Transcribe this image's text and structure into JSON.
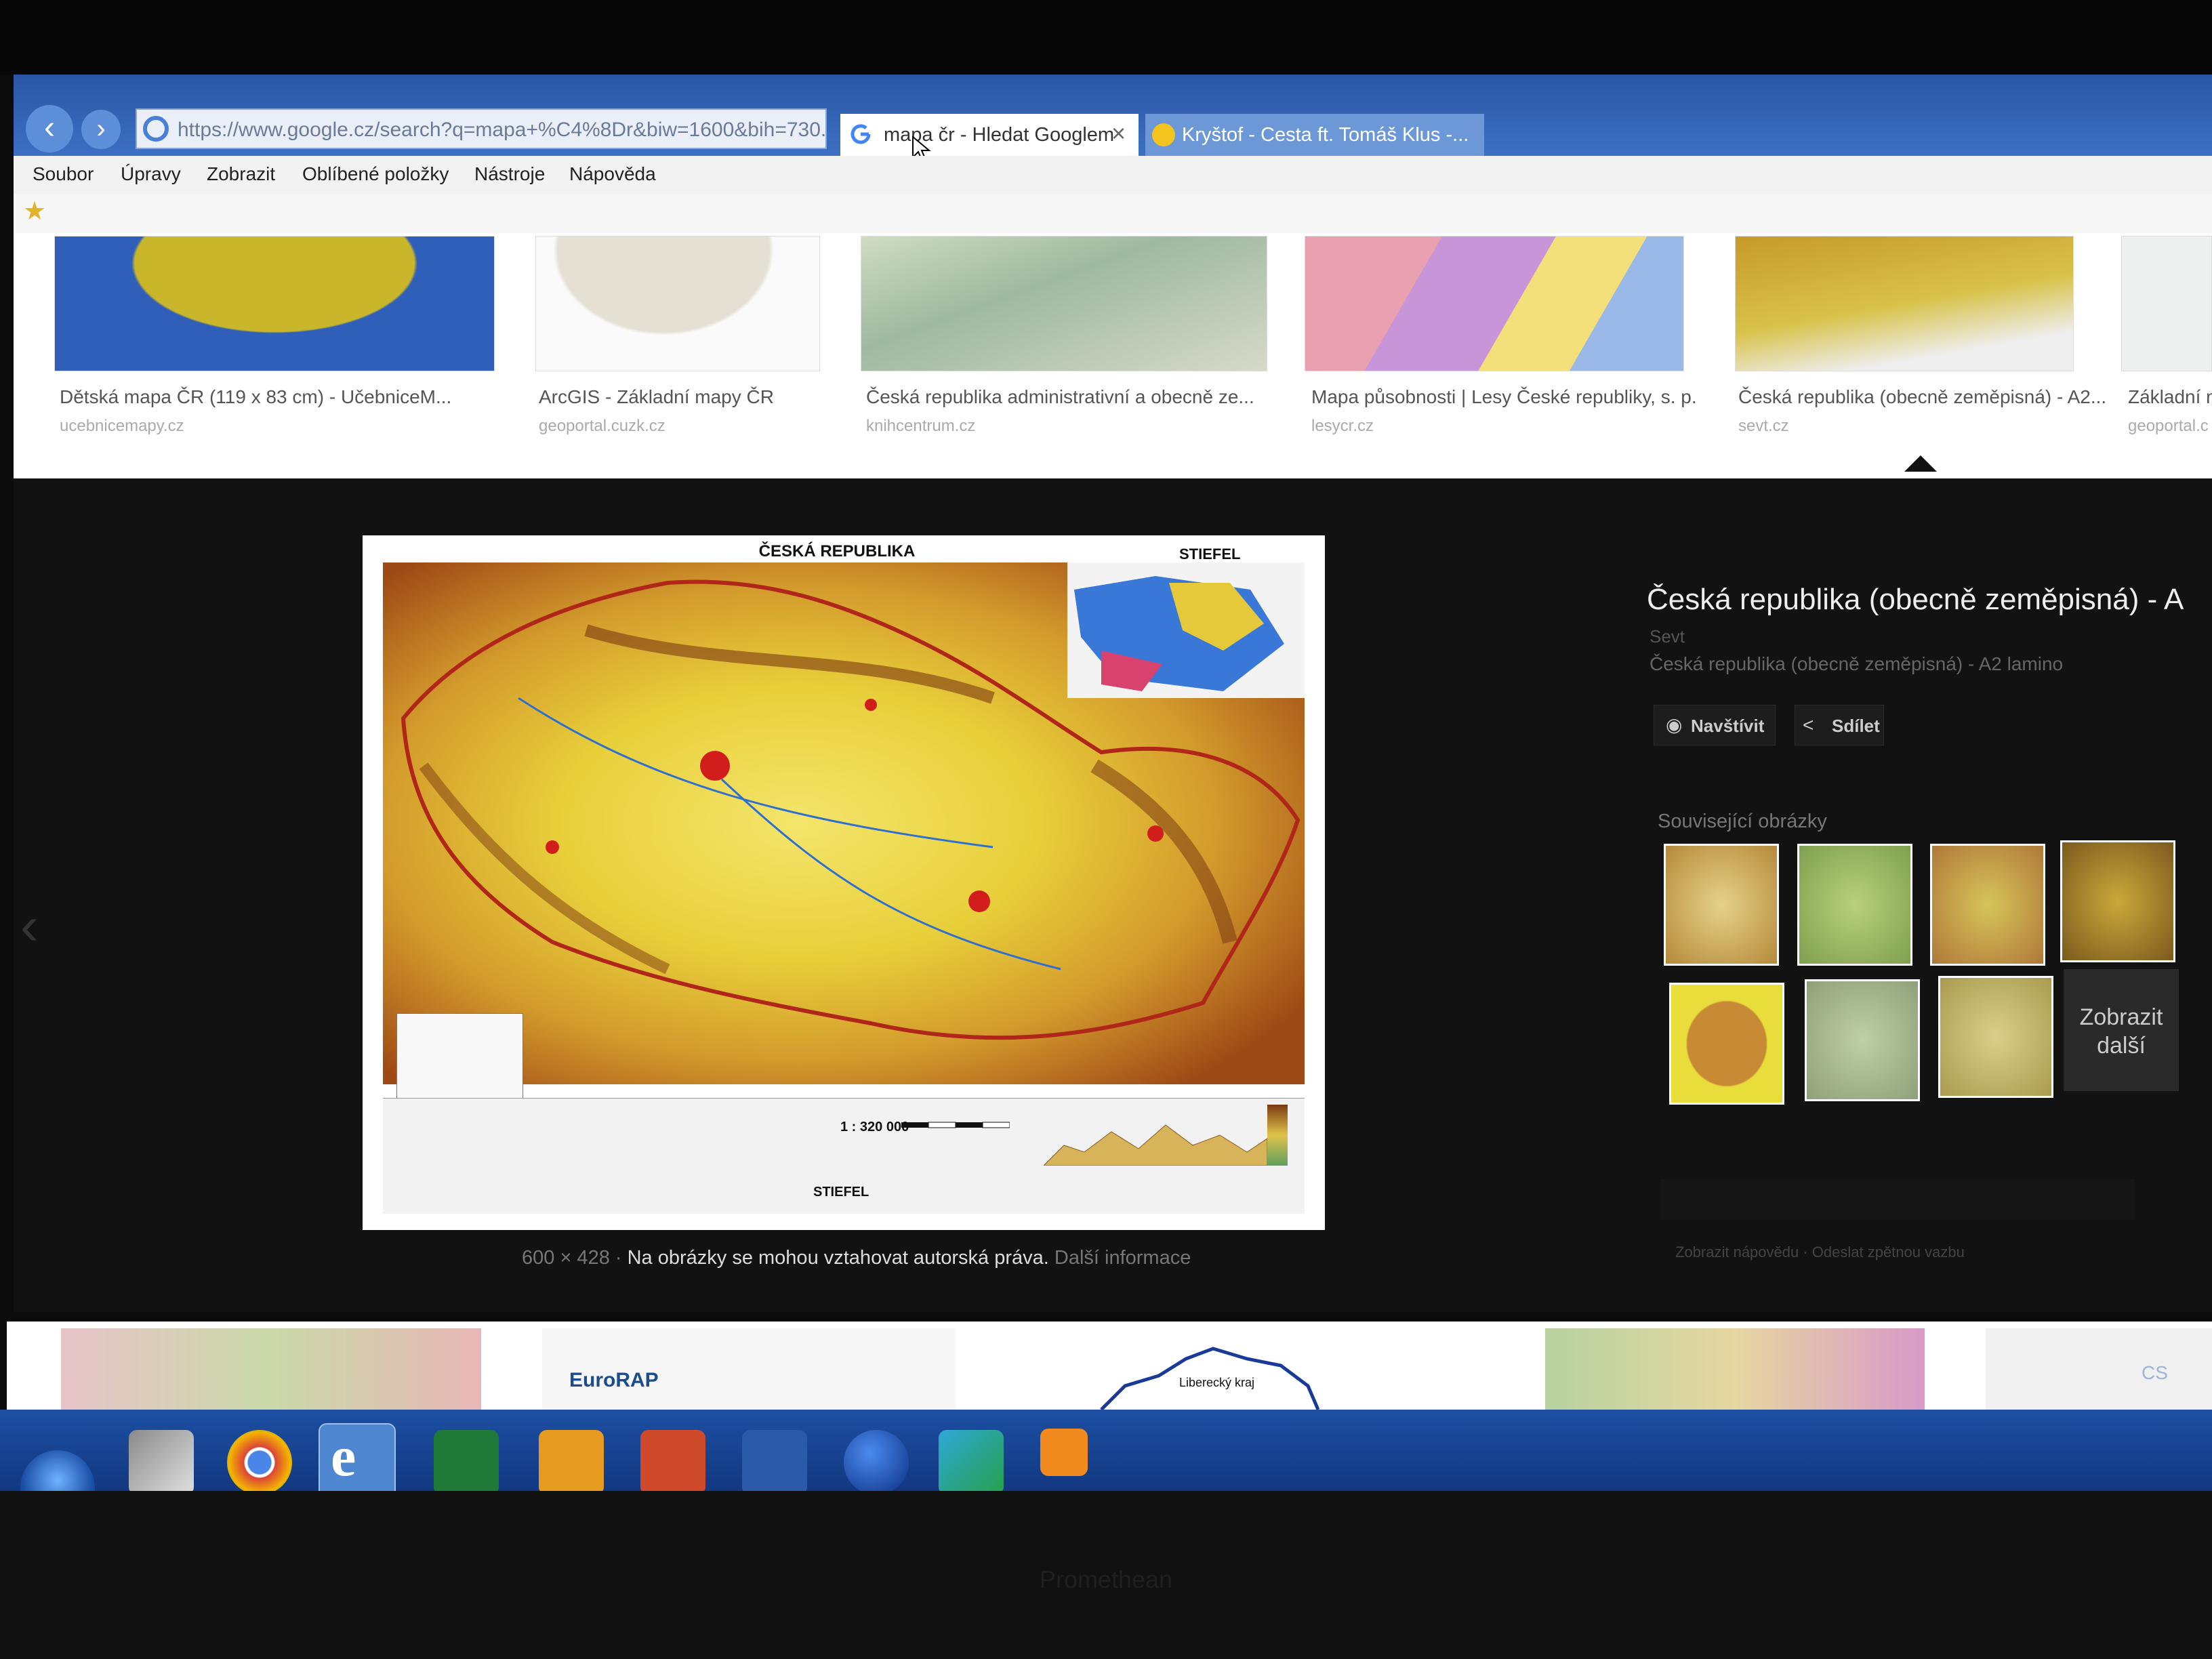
{
  "browser": {
    "address": "https://www.google.cz/search?q=mapa+%C4%8Dr&biw=1600&bih=730...",
    "tabs": [
      {
        "label": "mapa čr - Hledat Googlem",
        "active": true
      },
      {
        "label": "Kryštof - Cesta ft. Tomáš Klus -...",
        "active": false
      }
    ],
    "menu": [
      "Soubor",
      "Úpravy",
      "Zobrazit",
      "Oblíbené položky",
      "Nástroje",
      "Nápověda"
    ]
  },
  "results_row": [
    {
      "title": "Dětská mapa ČR (119 x 83 cm) - UčebniceM...",
      "source": "ucebnicemapy.cz"
    },
    {
      "title": "ArcGIS - Základní mapy ČR",
      "source": "geoportal.cuzk.cz"
    },
    {
      "title": "Česká republika administrativní a obecně ze...",
      "source": "knihcentrum.cz"
    },
    {
      "title": "Mapa působnosti | Lesy České republiky, s. p.",
      "source": "lesycr.cz"
    },
    {
      "title": "Česká republika (obecně zeměpisná) - A2...",
      "source": "sevt.cz"
    },
    {
      "title": "Základní m",
      "source": "geoportal.c"
    }
  ],
  "preview": {
    "map_title": "ČESKÁ REPUBLIKA",
    "map_brand": "STIEFEL",
    "map_scale": "1 : 320 000",
    "map_footer": "STIEFEL",
    "dimensions": "600 × 428",
    "copyright_note": "Na obrázky se mohou vztahovat autorská práva.",
    "more_info": "Další informace"
  },
  "info_panel": {
    "title": "Česká republika (obecně zeměpisná) - A",
    "source": "Sevt",
    "subtitle": "Česká republika (obecně zeměpisná) - A2 lamino",
    "visit_label": "Navštívit",
    "share_label": "Sdílet",
    "related_heading": "Související obrázky",
    "more_label": "Zobrazit další",
    "help_links": "Zobrazit nápovědu · Odeslat zpětnou vazbu"
  },
  "lower_strip": {
    "eurorap": "EuroRAP",
    "liberec": "Liberecký kraj"
  },
  "taskbar": {
    "lang": "CS",
    "monitor_brand": "Promethean"
  },
  "colors": {
    "tab_bar": "#2a56a5",
    "map_yellow": "#e8d237",
    "map_brown": "#a0521c"
  }
}
